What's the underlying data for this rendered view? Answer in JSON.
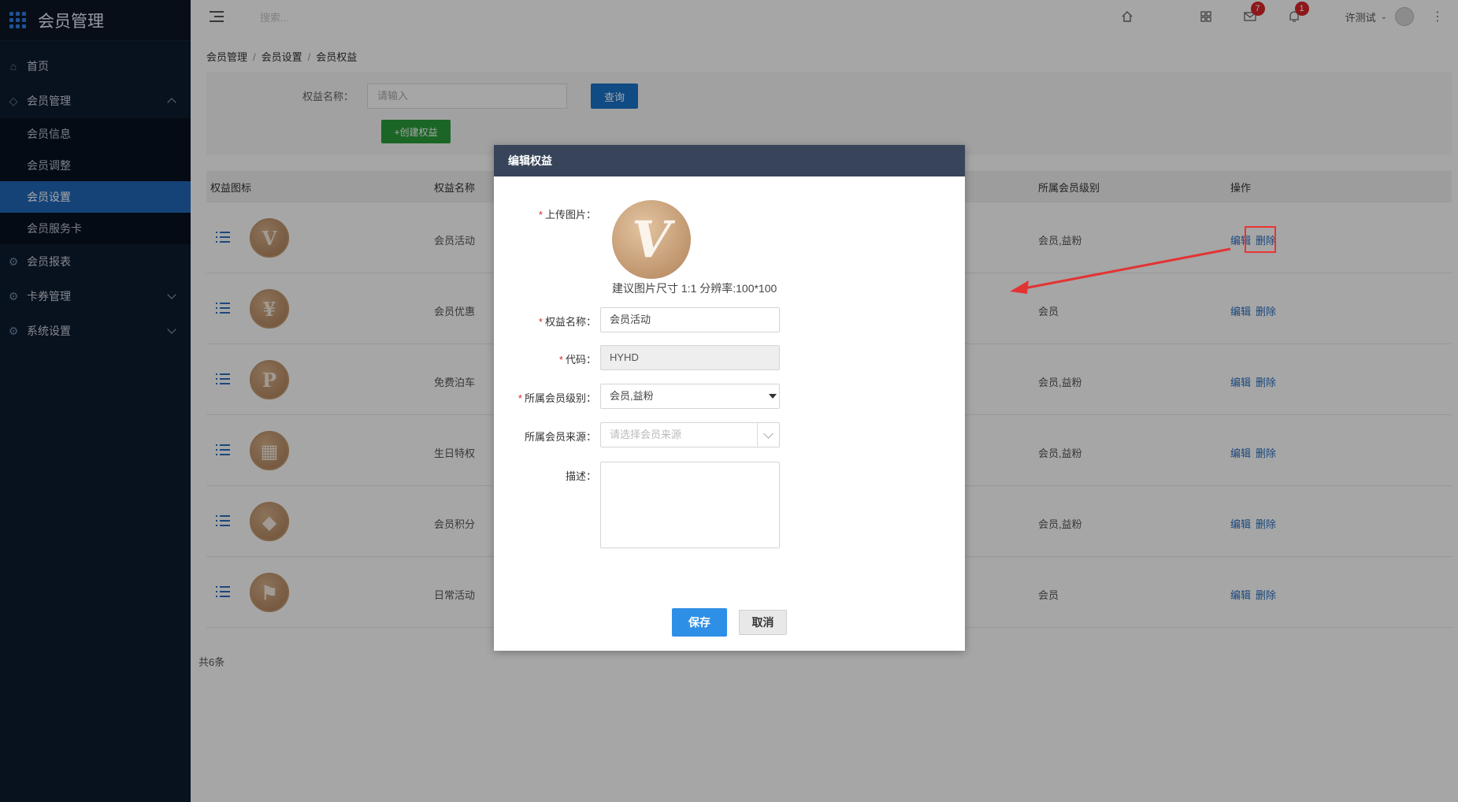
{
  "app": {
    "title": "会员管理"
  },
  "sidebar": {
    "items": [
      {
        "label": "首页"
      },
      {
        "label": "会员管理"
      },
      {
        "label": "会员报表"
      },
      {
        "label": "卡券管理"
      },
      {
        "label": "系统设置"
      }
    ],
    "sub_items": [
      {
        "label": "会员信息"
      },
      {
        "label": "会员调整"
      },
      {
        "label": "会员设置"
      },
      {
        "label": "会员服务卡"
      }
    ]
  },
  "header": {
    "search_placeholder": "搜索...",
    "mail_badge": "7",
    "bell_badge": "1",
    "user_name": "许测试"
  },
  "breadcrumb": [
    "会员管理",
    "会员设置",
    "会员权益"
  ],
  "filter": {
    "label": "权益名称：",
    "placeholder": "请输入",
    "query_label": "查询",
    "create_label": "+创建权益"
  },
  "table": {
    "headers": {
      "icon": "权益图标",
      "name": "权益名称",
      "level": "所属会员级别",
      "ops": "操作"
    },
    "rows": [
      {
        "medal": "V",
        "name": "会员活动",
        "level": "会员,益粉",
        "edit": "编辑",
        "delete": "删除"
      },
      {
        "medal": "¥",
        "name": "会员优惠",
        "level": "会员",
        "edit": "编辑",
        "delete": "删除"
      },
      {
        "medal": "P",
        "name": "免费泊车",
        "level": "会员,益粉",
        "edit": "编辑",
        "delete": "删除"
      },
      {
        "medal": "▦",
        "name": "生日特权",
        "level": "会员,益粉",
        "edit": "编辑",
        "delete": "删除"
      },
      {
        "medal": "◆",
        "name": "会员积分",
        "level": "会员,益粉",
        "edit": "编辑",
        "delete": "删除"
      },
      {
        "medal": "⚑",
        "name": "日常活动",
        "level": "会员",
        "edit": "编辑",
        "delete": "删除"
      }
    ],
    "total": "共6条"
  },
  "dialog": {
    "title": "编辑权益",
    "upload_label": "上传图片：",
    "upload_glyph": "V",
    "upload_hint": "建议图片尺寸 1:1 分辨率:100*100",
    "name_label": "权益名称：",
    "name_value": "会员活动",
    "code_label": "代码：",
    "code_value": "HYHD",
    "level_label": "所属会员级别：",
    "level_value": "会员,益粉",
    "source_label": "所属会员来源：",
    "source_placeholder": "请选择会员来源",
    "desc_label": "描述：",
    "save_label": "保存",
    "cancel_label": "取消"
  },
  "colors": {
    "accent": "#1a73c9",
    "sidebar": "#0d1b2e",
    "dialog_header": "#37445a",
    "annotation": "#e33333"
  }
}
